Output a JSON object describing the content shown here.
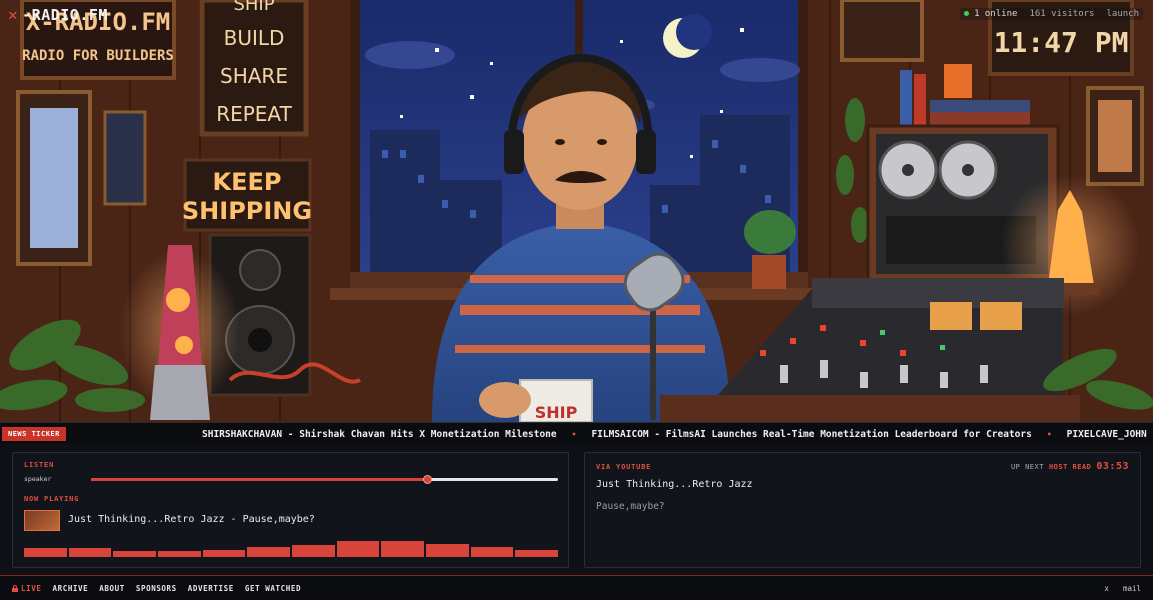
{
  "brand": {
    "name": "-RADIO.FM",
    "icon": "x-logo-icon"
  },
  "status": {
    "online": "1 online",
    "visitors": "161 visitors",
    "launch": "launch"
  },
  "scene": {
    "description_icon": "radio-host-illustration",
    "sign_top_left_1": "X-RADIO.FM",
    "sign_top_left_2": "RADIO FOR BUILDERS",
    "sign_motto": [
      "SHIP",
      "BUILD",
      "SHARE",
      "REPEAT"
    ],
    "sign_keep": [
      "KEEP",
      "SHIPPING"
    ],
    "clock": "11:47 PM",
    "mug_text": "SHIP"
  },
  "ticker": {
    "label": "News Ticker",
    "items": [
      "SHIRSHAKCHAVAN - Shirshak Chavan Hits X Monetization Milestone",
      "FILMSAICOM - FilmsAI Launches Real-Time Monetization Leaderboard for Creators",
      "PIXELCAVE_JOHN - Shad"
    ],
    "separator": "•"
  },
  "listen": {
    "label": "Listen",
    "speaker_label": "speaker",
    "volume": 0.72,
    "now_playing_label": "Now Playing",
    "now_playing": "Just Thinking...Retro Jazz - Pause,maybe?",
    "bars": [
      0.55,
      0.55,
      0.4,
      0.35,
      0.45,
      0.6,
      0.75,
      1.0,
      1.0,
      0.8,
      0.6,
      0.45
    ]
  },
  "youtube": {
    "label": "Via YouTube",
    "up_next": "Up Next",
    "host_read": "Host Read",
    "timer": "03:53",
    "title": "Just Thinking...Retro Jazz",
    "subtitle": "Pause,maybe?"
  },
  "footer": {
    "nav": [
      "Live",
      "Archive",
      "About",
      "Sponsors",
      "Advertise",
      "Get Watched"
    ],
    "social": [
      "x",
      "mail"
    ]
  },
  "colors": {
    "accent": "#e0503e",
    "bg": "#0e1016",
    "panel": "#12141b"
  }
}
